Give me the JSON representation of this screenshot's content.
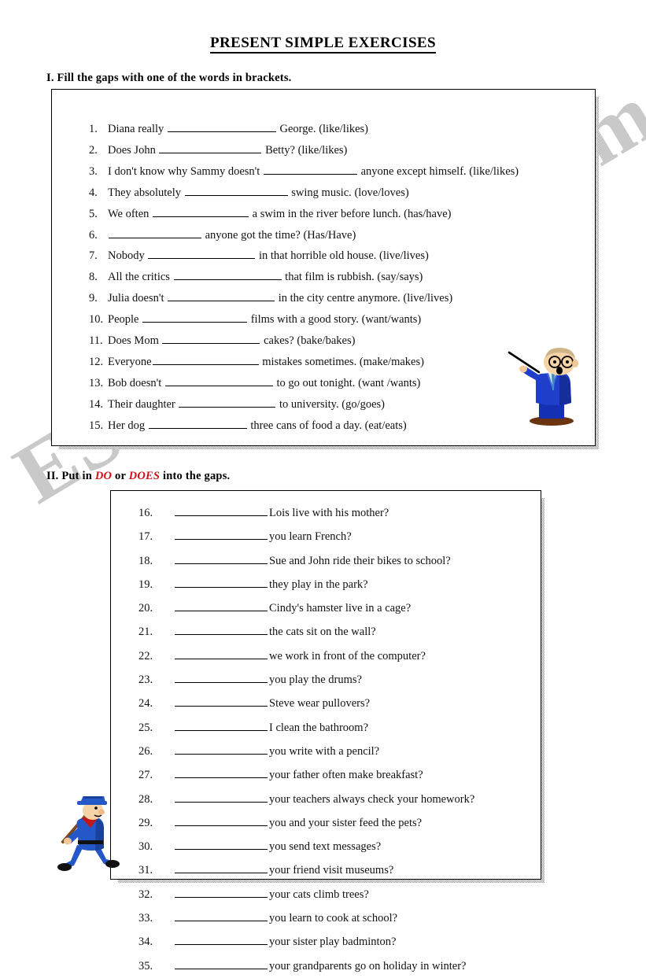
{
  "document": {
    "title": "PRESENT SIMPLE EXERCISES",
    "watermark": "ESLprintables.com",
    "accent_red": "#d40f19",
    "watermark_color": "#c9c9c9"
  },
  "section1": {
    "heading": "I. Fill the gaps with one of the words in brackets.",
    "items": [
      {
        "num": "1.",
        "lead": "Diana really ",
        "blank_width": 138,
        "tail": " George. ",
        "hint": "(like/likes)"
      },
      {
        "num": "2.",
        "lead": "Does John ",
        "blank_width": 130,
        "tail": " Betty? ",
        "hint": "(like/likes)"
      },
      {
        "num": "3.",
        "lead": "I don't know why Sammy doesn't ",
        "blank_width": 119,
        "tail": " anyone except himself. ",
        "hint": "(like/likes)"
      },
      {
        "num": "4.",
        "lead": "They absolutely ",
        "blank_width": 131,
        "tail": " swing music. ",
        "hint": "(love/loves)"
      },
      {
        "num": "5.",
        "lead": "We often ",
        "blank_width": 122,
        "tail": " a swim in the river before lunch. ",
        "hint": "(has/have)"
      },
      {
        "num": "6.",
        "lead": "",
        "blank_width": 118,
        "tail": " anyone got the time? ",
        "hint": "(Has/Have)"
      },
      {
        "num": "7.",
        "lead": "Nobody ",
        "blank_width": 136,
        "tail": " in that horrible old house. ",
        "hint": "(live/lives)"
      },
      {
        "num": "8.",
        "lead": "All the critics ",
        "blank_width": 137,
        "tail": " that film is rubbish. ",
        "hint": "(say/says)"
      },
      {
        "num": "9.",
        "lead": "Julia doesn't ",
        "blank_width": 136,
        "tail": " in the city centre anymore. ",
        "hint": "(live/lives)"
      },
      {
        "num": "10.",
        "lead": "People ",
        "blank_width": 133,
        "tail": " films with a good story. ",
        "hint": "(want/wants)"
      },
      {
        "num": "11.",
        "lead": "Does Mom ",
        "blank_width": 124,
        "tail": " cakes? ",
        "hint": "(bake/bakes)"
      },
      {
        "num": "12.",
        "lead": "Everyone",
        "blank_width": 135,
        "tail": " mistakes sometimes. ",
        "hint": "(make/makes)"
      },
      {
        "num": "13.",
        "lead": "Bob doesn't ",
        "blank_width": 137,
        "tail": " to go out tonight. ",
        "hint": "(want /wants)"
      },
      {
        "num": "14.",
        "lead": "Their daughter ",
        "blank_width": 123,
        "tail": " to university. ",
        "hint": "(go/goes)"
      },
      {
        "num": "15.",
        "lead": "Her dog ",
        "blank_width": 125,
        "tail": " three cans of food a day. ",
        "hint": "(eat/eats)"
      }
    ]
  },
  "section2": {
    "heading_before": "II. Put in ",
    "heading_word1": "DO",
    "heading_middle": " or ",
    "heading_word2": "DOES",
    "heading_after": " into the gaps.",
    "items": [
      {
        "num": "16.",
        "tail": "Lois live with his mother?"
      },
      {
        "num": "17.",
        "tail": "you learn French?"
      },
      {
        "num": "18.",
        "tail": "Sue and John ride their bikes to school?"
      },
      {
        "num": "19.",
        "tail": "they play in the park?"
      },
      {
        "num": "20.",
        "tail": "Cindy's hamster live in a cage?"
      },
      {
        "num": "21.",
        "tail": "the cats sit on the wall?"
      },
      {
        "num": "22.",
        "tail": "we work in front of the computer?"
      },
      {
        "num": "23.",
        "tail": "you play the drums?"
      },
      {
        "num": "24.",
        "tail": "Steve wear pullovers?"
      },
      {
        "num": "25.",
        "tail": "I clean the bathroom?"
      },
      {
        "num": "26.",
        "tail": "you write with a pencil?"
      },
      {
        "num": "27.",
        "tail": "your father often make breakfast?"
      },
      {
        "num": "28.",
        "tail": "your teachers always check your homework?"
      },
      {
        "num": "29.",
        "tail": "you and your sister feed the pets?"
      },
      {
        "num": "30.",
        "tail": "you send text messages?"
      },
      {
        "num": "31.",
        "tail": "your friend visit museums?"
      },
      {
        "num": "32.",
        "tail": "your cats climb trees?"
      },
      {
        "num": "33.",
        "tail": "you learn to cook at school?"
      },
      {
        "num": "34.",
        "tail": "your sister play badminton?"
      },
      {
        "num": "35.",
        "tail": "your grandparents go on holiday in winter?"
      }
    ]
  },
  "clipart": {
    "teacher": "teacher-with-pointer",
    "soldier": "marching-soldier-with-rifle"
  }
}
